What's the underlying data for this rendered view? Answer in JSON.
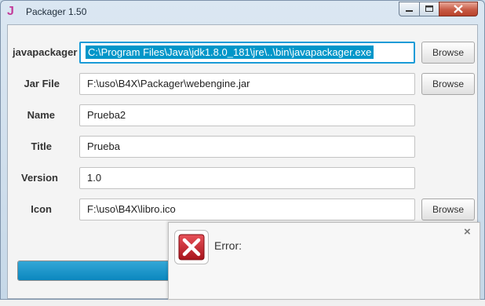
{
  "window": {
    "title": "Packager 1.50",
    "app_icon": "J",
    "controls": [
      "minimize-icon",
      "maximize-icon",
      "close-icon"
    ]
  },
  "form": {
    "rows": [
      {
        "label": "javapackager",
        "value": "C:\\Program Files\\Java\\jdk1.8.0_181\\jre\\..\\bin\\javapackager.exe",
        "has_browse": true,
        "focused": true
      },
      {
        "label": "Jar File",
        "value": "F:\\uso\\B4X\\Packager\\webengine.jar",
        "has_browse": true
      },
      {
        "label": "Name",
        "value": "Prueba2",
        "has_browse": false
      },
      {
        "label": "Title",
        "value": "Prueba",
        "has_browse": false
      },
      {
        "label": "Version",
        "value": "1.0",
        "has_browse": false
      },
      {
        "label": "Icon",
        "value": "F:\\uso\\B4X\\libro.ico",
        "has_browse": true
      }
    ],
    "browse_label": "Browse"
  },
  "progress": {
    "fraction": 1.0
  },
  "notification": {
    "message": "Error:",
    "icon": "error-x-icon",
    "close_glyph": "×"
  },
  "colors": {
    "accent": "#0096c9",
    "error": "#c0272d",
    "close_button": "#c75b45"
  }
}
